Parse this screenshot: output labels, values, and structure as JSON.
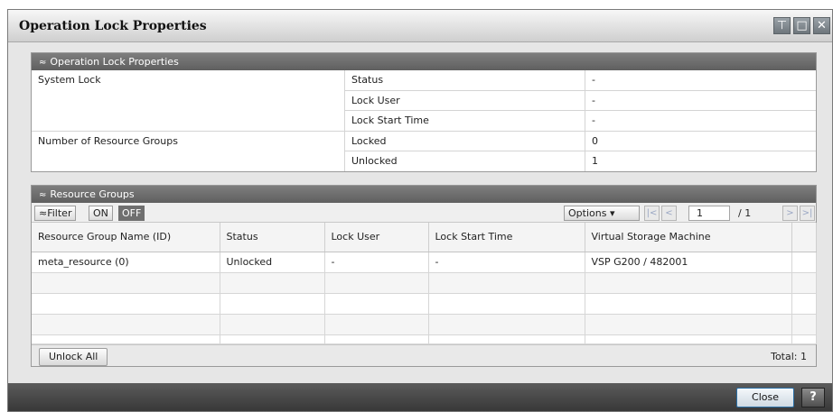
{
  "window": {
    "title": "Operation Lock Properties",
    "controls": {
      "minimize": "⊤",
      "maximize": "□",
      "close": "✕"
    }
  },
  "props_panel": {
    "header": "Operation Lock Properties",
    "system_lock_label": "System Lock",
    "resource_groups_label": "Number of Resource Groups",
    "rows": [
      {
        "label": "Status",
        "value": "-"
      },
      {
        "label": "Lock User",
        "value": "-"
      },
      {
        "label": "Lock Start Time",
        "value": "-"
      },
      {
        "label": "Locked",
        "value": "0"
      },
      {
        "label": "Unlocked",
        "value": "1"
      }
    ]
  },
  "rg_panel": {
    "header": "Resource Groups",
    "filter_label": "Filter",
    "on_label": "ON",
    "off_label": "OFF",
    "options_label": "Options",
    "page_value": "1",
    "page_total": "/ 1",
    "columns": [
      "Resource Group Name (ID)",
      "Status",
      "Lock User",
      "Lock Start Time",
      "Virtual Storage Machine"
    ],
    "rows": [
      [
        "meta_resource (0)",
        "Unlocked",
        "-",
        "-",
        "VSP G200 / 482001"
      ]
    ],
    "unlock_all_label": "Unlock All",
    "total_label": "Total:",
    "total_value": "1"
  },
  "footer": {
    "close_label": "Close",
    "help_label": "?"
  }
}
